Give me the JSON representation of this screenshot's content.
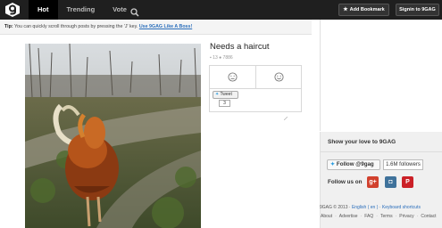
{
  "topbar": {
    "logo": "9gag-logo",
    "nav": [
      {
        "label": "Hot",
        "active": true
      },
      {
        "label": "Trending",
        "active": false
      },
      {
        "label": "Vote",
        "active": false
      }
    ],
    "search_icon": "search-icon",
    "bookmark_label": "Add Bookmark",
    "signin_label": "Signin to 9GAG"
  },
  "tip": {
    "prefix": "Tip:",
    "text": "You can quickly scroll through posts by pressing the 'J' key.",
    "link": "Use 9GAG Like A Boss!"
  },
  "post": {
    "title": "Needs a haircut",
    "comments": "13",
    "points": "7886",
    "tweet_label": "Tweet",
    "tweet_count": "3",
    "image_alt": "rooster"
  },
  "sidebar": {
    "heading": "Show your love to 9GAG",
    "follow_label": "Follow @9gag",
    "followers": "1.6M followers",
    "follow_us": "Follow us on",
    "social": [
      "google-plus-icon",
      "instagram-icon",
      "pinterest-icon"
    ],
    "copyright": "9GAG © 2013 · ",
    "language": "English ( en )",
    "sep_dot": " · ",
    "shortcuts": "Keyboard shortcuts",
    "footer": [
      "About",
      "Advertise",
      "FAQ",
      "Terms",
      "Privacy",
      "Contact"
    ]
  },
  "colors": {
    "topbar_bg": "#1f1f1f",
    "link": "#2a6ebb",
    "google_plus": "#d1402d",
    "instagram": "#3f729b",
    "pinterest": "#cb2027"
  }
}
